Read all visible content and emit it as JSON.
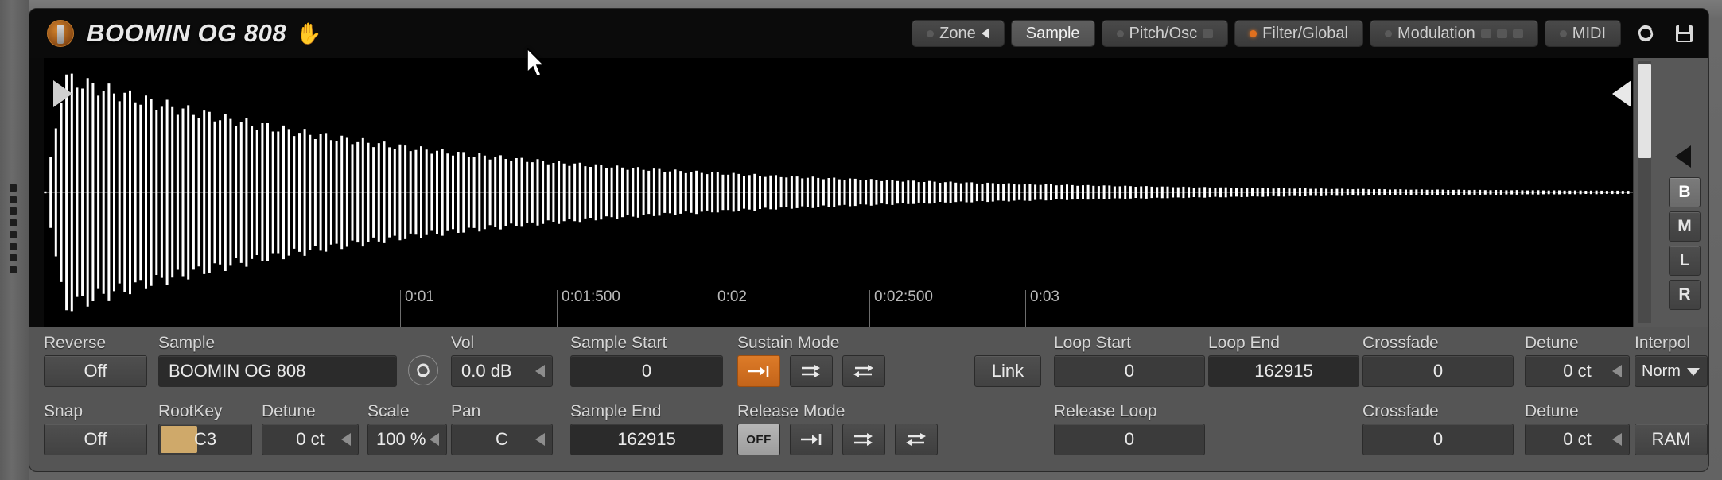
{
  "header": {
    "instrument_icon": "instrument-round-icon",
    "title": "BOOMIN OG 808",
    "hand_icon": "✋",
    "tabs": [
      {
        "label": "Zone",
        "active": false,
        "dot": "off",
        "caret": true
      },
      {
        "label": "Sample",
        "active": true,
        "dot": "none",
        "caret": false
      },
      {
        "label": "Pitch/Osc",
        "active": false,
        "dot": "off",
        "caret": false
      },
      {
        "label": "Filter/Global",
        "active": false,
        "dot": "on",
        "caret": false
      },
      {
        "label": "Modulation",
        "active": false,
        "dot": "off",
        "caret": false
      },
      {
        "label": "MIDI",
        "active": false,
        "dot": "off",
        "caret": false
      }
    ],
    "refresh_icon": "↻",
    "save_icon": "save-disk-icon"
  },
  "waveform": {
    "time_labels": [
      "0:01",
      "0:01:500",
      "0:02",
      "0:02:500",
      "0:03"
    ],
    "start_marker": "sample-start-marker",
    "end_marker": "sample-end-marker",
    "duration_label": "0:03"
  },
  "right_toolbar": {
    "collapse_icon": "◁",
    "buttons": [
      {
        "label": "B",
        "active": true
      },
      {
        "label": "M",
        "active": false
      },
      {
        "label": "L",
        "active": false
      },
      {
        "label": "R",
        "active": false
      }
    ]
  },
  "controls": {
    "row1": {
      "reverse_label": "Reverse",
      "reverse_value": "Off",
      "sample_label": "Sample",
      "sample_value": "BOOMIN OG 808",
      "reload_icon": "↻",
      "vol_label": "Vol",
      "vol_value": "0.0 dB",
      "sample_start_label": "Sample Start",
      "sample_start_value": "0",
      "sustain_mode_label": "Sustain Mode",
      "sustain_modes": [
        {
          "icon": "arrow-to-bar-icon",
          "active": true
        },
        {
          "icon": "loop-forward-icon",
          "active": false
        },
        {
          "icon": "loop-alternate-icon",
          "active": false
        }
      ],
      "link_label": "Link",
      "loop_start_label": "Loop Start",
      "loop_start_value": "0",
      "loop_end_label": "Loop End",
      "loop_end_value": "162915",
      "crossfade_label": "Crossfade",
      "crossfade_value": "0",
      "detune_label": "Detune",
      "detune_value": "0 ct",
      "interpol_label": "Interpol",
      "interpol_value": "Norm"
    },
    "row2": {
      "snap_label": "Snap",
      "snap_value": "Off",
      "rootkey_label": "RootKey",
      "rootkey_value": "C3",
      "detune_label": "Detune",
      "detune_value": "0 ct",
      "scale_label": "Scale",
      "scale_value": "100 %",
      "pan_label": "Pan",
      "pan_value": "C",
      "sample_end_label": "Sample End",
      "sample_end_value": "162915",
      "release_mode_label": "Release Mode",
      "release_modes": [
        {
          "icon": "off-text-icon",
          "label": "OFF",
          "active": true
        },
        {
          "icon": "arrow-to-bar-icon",
          "active": false
        },
        {
          "icon": "loop-forward-icon",
          "active": false
        },
        {
          "icon": "loop-alternate-icon",
          "active": false
        }
      ],
      "release_loop_label": "Release Loop",
      "release_loop_value": "0",
      "crossfade_label": "Crossfade",
      "crossfade_value": "0",
      "detune2_label": "Detune",
      "detune2_value": "0 ct",
      "ram_label": "RAM"
    }
  },
  "colors": {
    "accent": "#dd7b28",
    "rootkey_highlight": "#cfa96a",
    "panel_bg": "#555555",
    "wave_bg": "#000000"
  }
}
